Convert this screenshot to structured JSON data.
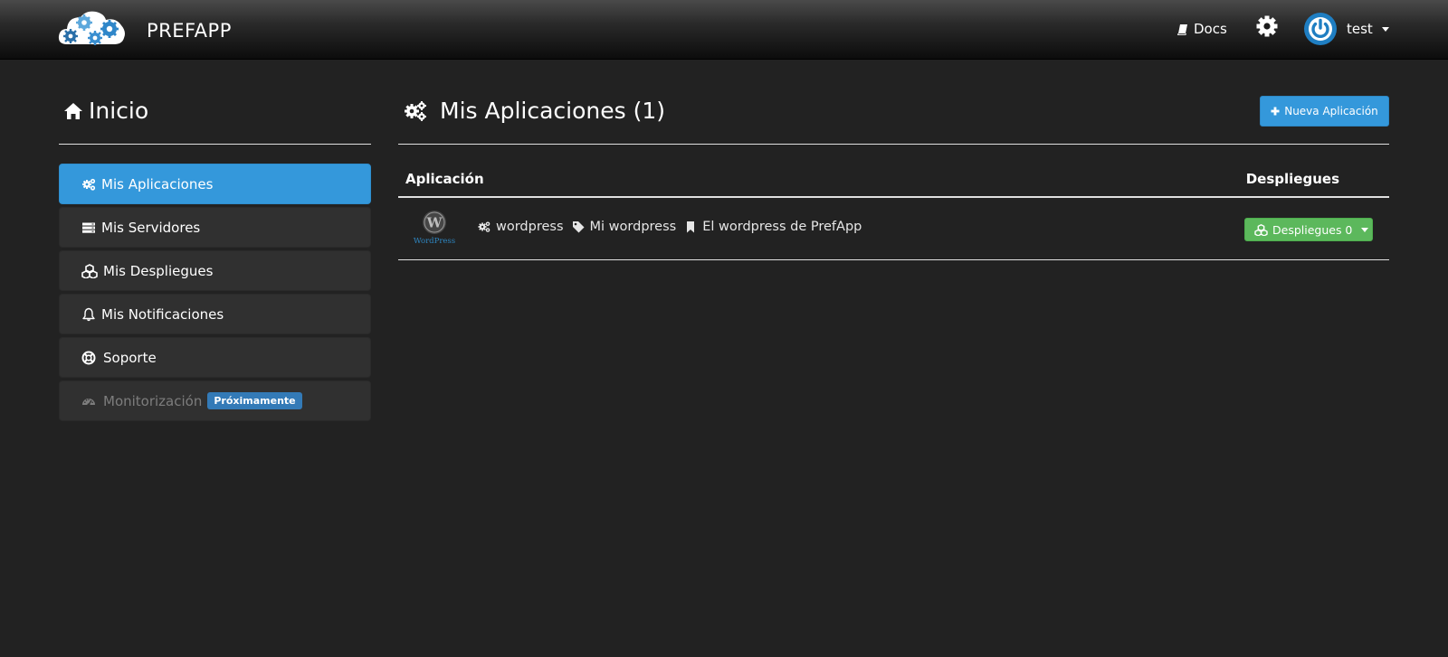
{
  "navbar": {
    "brand": "PREFAPP",
    "docs_label": "Docs",
    "user_name": "test",
    "icons": {
      "docs": "book-icon",
      "settings": "gear-icon",
      "avatar": "power-icon"
    }
  },
  "sidebar": {
    "title": "Inicio",
    "items": [
      {
        "label": "Mis Aplicaciones",
        "icon": "cogs-icon",
        "active": true
      },
      {
        "label": "Mis Servidores",
        "icon": "server-icon"
      },
      {
        "label": "Mis Despliegues",
        "icon": "cubes-icon"
      },
      {
        "label": "Mis Notificaciones",
        "icon": "bell-icon"
      },
      {
        "label": "Soporte",
        "icon": "life-ring-icon"
      },
      {
        "label": "Monitorización",
        "icon": "dashboard-icon",
        "disabled": true,
        "badge": "Próximamente"
      }
    ]
  },
  "main": {
    "title": "Mis Aplicaciones (1)",
    "new_button": "Nueva Aplicación",
    "table": {
      "headers": [
        "Aplicación",
        "Despliegues"
      ],
      "rows": [
        {
          "logo": "wordpress-logo",
          "app_name": "wordpress",
          "tag": "Mi wordpress",
          "description": "El wordpress de PrefApp",
          "deploy_label": "Despliegues 0"
        }
      ]
    }
  },
  "colors": {
    "background": "#222222",
    "primary": "#3498db",
    "success": "#5cb85c",
    "badge": "#337ab7",
    "avatar": "#1f7ec2"
  }
}
